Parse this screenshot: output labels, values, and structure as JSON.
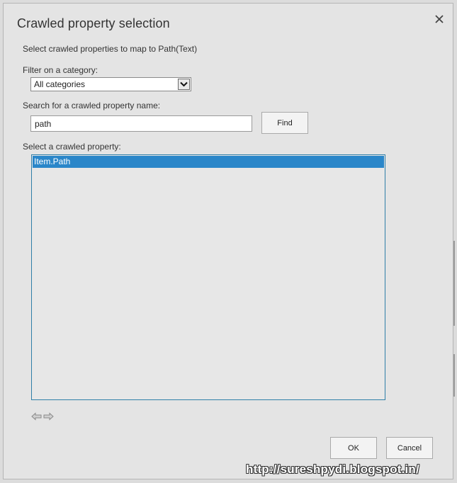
{
  "dialog": {
    "title": "Crawled property selection",
    "intro": "Select crawled properties to map to Path(Text)",
    "filter": {
      "label": "Filter on a category:",
      "selected": "All categories"
    },
    "search": {
      "label": "Search for a crawled property name:",
      "value": "path",
      "find_label": "Find"
    },
    "list": {
      "label": "Select a crawled property:",
      "items": [
        "Item.Path"
      ],
      "selected_index": 0
    },
    "ok_label": "OK",
    "cancel_label": "Cancel"
  },
  "watermark": "http://sureshpydi.blogspot.in/",
  "icons": {
    "close": "close-icon",
    "dropdown": "chevron-down-icon",
    "prev": "arrow-left-icon",
    "next": "arrow-right-icon"
  },
  "colors": {
    "selection": "#2a86c9",
    "list_border": "#2f7fa8",
    "dialog_bg": "#e4e4e4"
  }
}
